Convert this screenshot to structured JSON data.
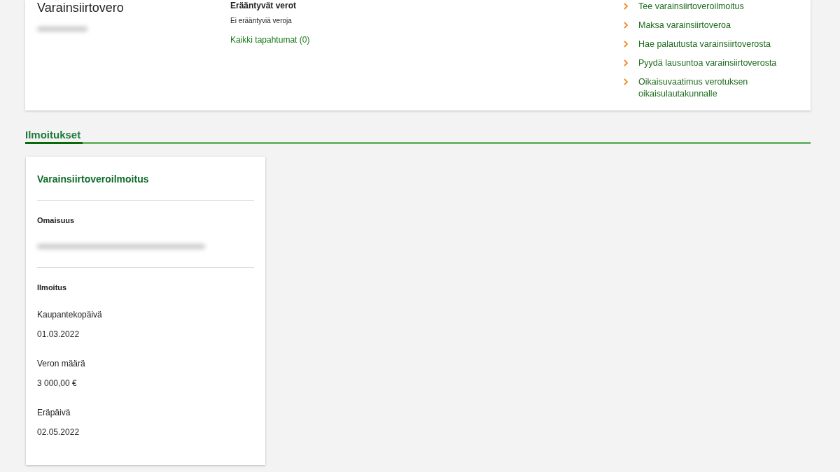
{
  "overview": {
    "title": "Varainsiirtovero",
    "due_taxes": {
      "heading": "Erääntyvät verot",
      "status": "Ei erääntyviä veroja",
      "link": "Kaikki tapahtumat (0)"
    },
    "actions": [
      "Tee varainsiirtoveroilmoitus",
      "Maksa varainsiirtoveroa",
      "Hae palautusta varainsiirtoverosta",
      "Pyydä lausuntoa varainsiirtoverosta",
      "Oikaisuvaatimus verotuksen oikaisulautakunnalle"
    ]
  },
  "tabs": [
    {
      "label": "Ilmoitukset",
      "selected": true
    }
  ],
  "declaration_card": {
    "title": "Varainsiirtoveroilmoitus",
    "sections": [
      {
        "kind": "redacted",
        "heading": "Omaisuus"
      },
      {
        "kind": "fields",
        "heading": "Ilmoitus",
        "fields": [
          {
            "label": "Kaupantekopäivä",
            "value": "01.03.2022"
          },
          {
            "label": "Veron määrä",
            "value": "3 000,00 €"
          },
          {
            "label": "Eräpäivä",
            "value": "02.05.2022"
          }
        ]
      }
    ]
  }
}
